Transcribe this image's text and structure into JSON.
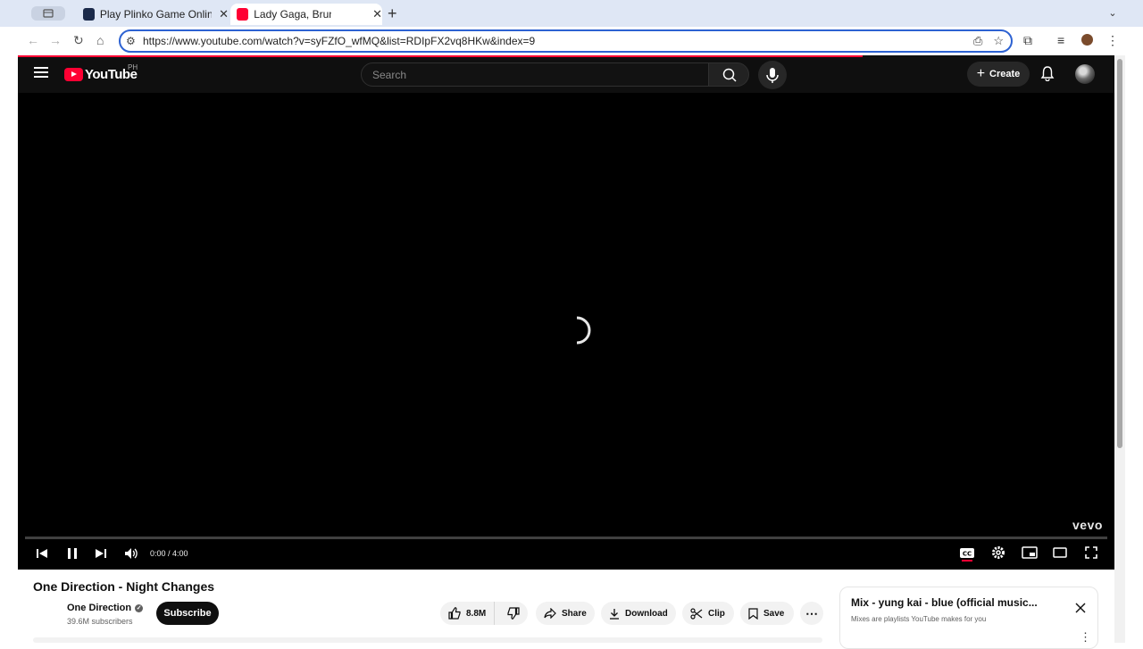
{
  "browser": {
    "tabs": [
      {
        "title": "Play Plinko Game Online for R",
        "active": false
      },
      {
        "title": "Lady Gaga, Bruno Mars - Die",
        "active": true
      }
    ],
    "address_bar": {
      "url": "https://www.youtube.com/watch?v=syFZfO_wfMQ&list=RDIpFX2vq8HKw&index=9"
    }
  },
  "youtube": {
    "logo_text": "YouTube",
    "region": "PH",
    "search": {
      "placeholder": "Search",
      "value": ""
    },
    "create_label": "Create"
  },
  "player": {
    "time": "0:00 / 4:00",
    "watermark": "vevo",
    "progress": 0
  },
  "video": {
    "title": "One Direction - Night Changes",
    "channel": {
      "name": "One Direction",
      "subscribers": "39.6M subscribers",
      "verified": true
    },
    "subscribe_label": "Subscribe",
    "actions": {
      "likes": "8.8M",
      "share": "Share",
      "download": "Download",
      "clip": "Clip",
      "save": "Save"
    }
  },
  "mix_panel": {
    "title": "Mix - yung kai - blue (official music...",
    "subtitle": "Mixes are playlists YouTube makes for you"
  },
  "colors": {
    "accent": "#ff0033",
    "omnibox_focus": "#2d62d2",
    "tabstrip": "#dfe7f5"
  }
}
